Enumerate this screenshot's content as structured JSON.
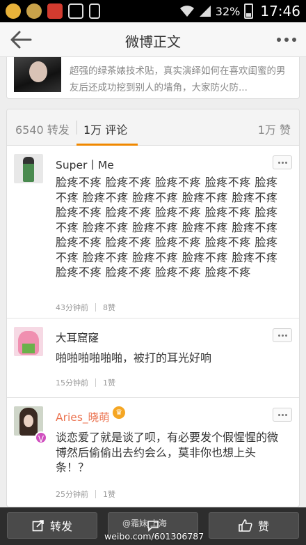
{
  "status_bar": {
    "battery": "32%",
    "time": "17:46"
  },
  "header": {
    "title": "微博正文"
  },
  "original_post": {
    "text": "超强的绿茶婊技术贴，真实演绎如何在喜欢闺蜜的男友后还成功挖到别人的墙角，大家防火防..."
  },
  "tabs": {
    "reposts": "6540 转发",
    "comments": "1万 评论",
    "likes": "1万 赞"
  },
  "comments": [
    {
      "name": "Super丨Me",
      "text": "脸疼不疼 脸疼不疼 脸疼不疼 脸疼不疼 脸疼不疼 脸疼不疼 脸疼不疼 脸疼不疼 脸疼不疼 脸疼不疼 脸疼不疼 脸疼不疼 脸疼不疼 脸疼不疼 脸疼不疼 脸疼不疼 脸疼不疼 脸疼不疼 脸疼不疼 脸疼不疼 脸疼不疼 脸疼不疼 脸疼不疼 脸疼不疼 脸疼不疼 脸疼不疼 脸疼不疼 脸疼不疼 脸疼不疼 脸疼不疼 脸疼不疼",
      "time": "43分钟前",
      "likes": "8赞"
    },
    {
      "name": "大耳窟窿",
      "text": "啪啪啪啪啪啪，被打的耳光好响",
      "time": "15分钟前",
      "likes": "1赞"
    },
    {
      "name": "Aries_晓萌",
      "text": "谈恋爱了就是谈了呗，有必要发个假惺惺的微博然后偷偷出去约会么，莫非你也想上头条！？",
      "time": "25分钟前",
      "likes": "1赞"
    }
  ],
  "toolbar": {
    "repost": "转发",
    "like": "赞"
  },
  "watermark": {
    "top": "@霜妹 上海",
    "bottom": "weibo.com/601306787"
  },
  "colors": {
    "accent": "#f08800",
    "vip_name": "#eb7350",
    "toolbar_bg": "#2d2d2d"
  }
}
